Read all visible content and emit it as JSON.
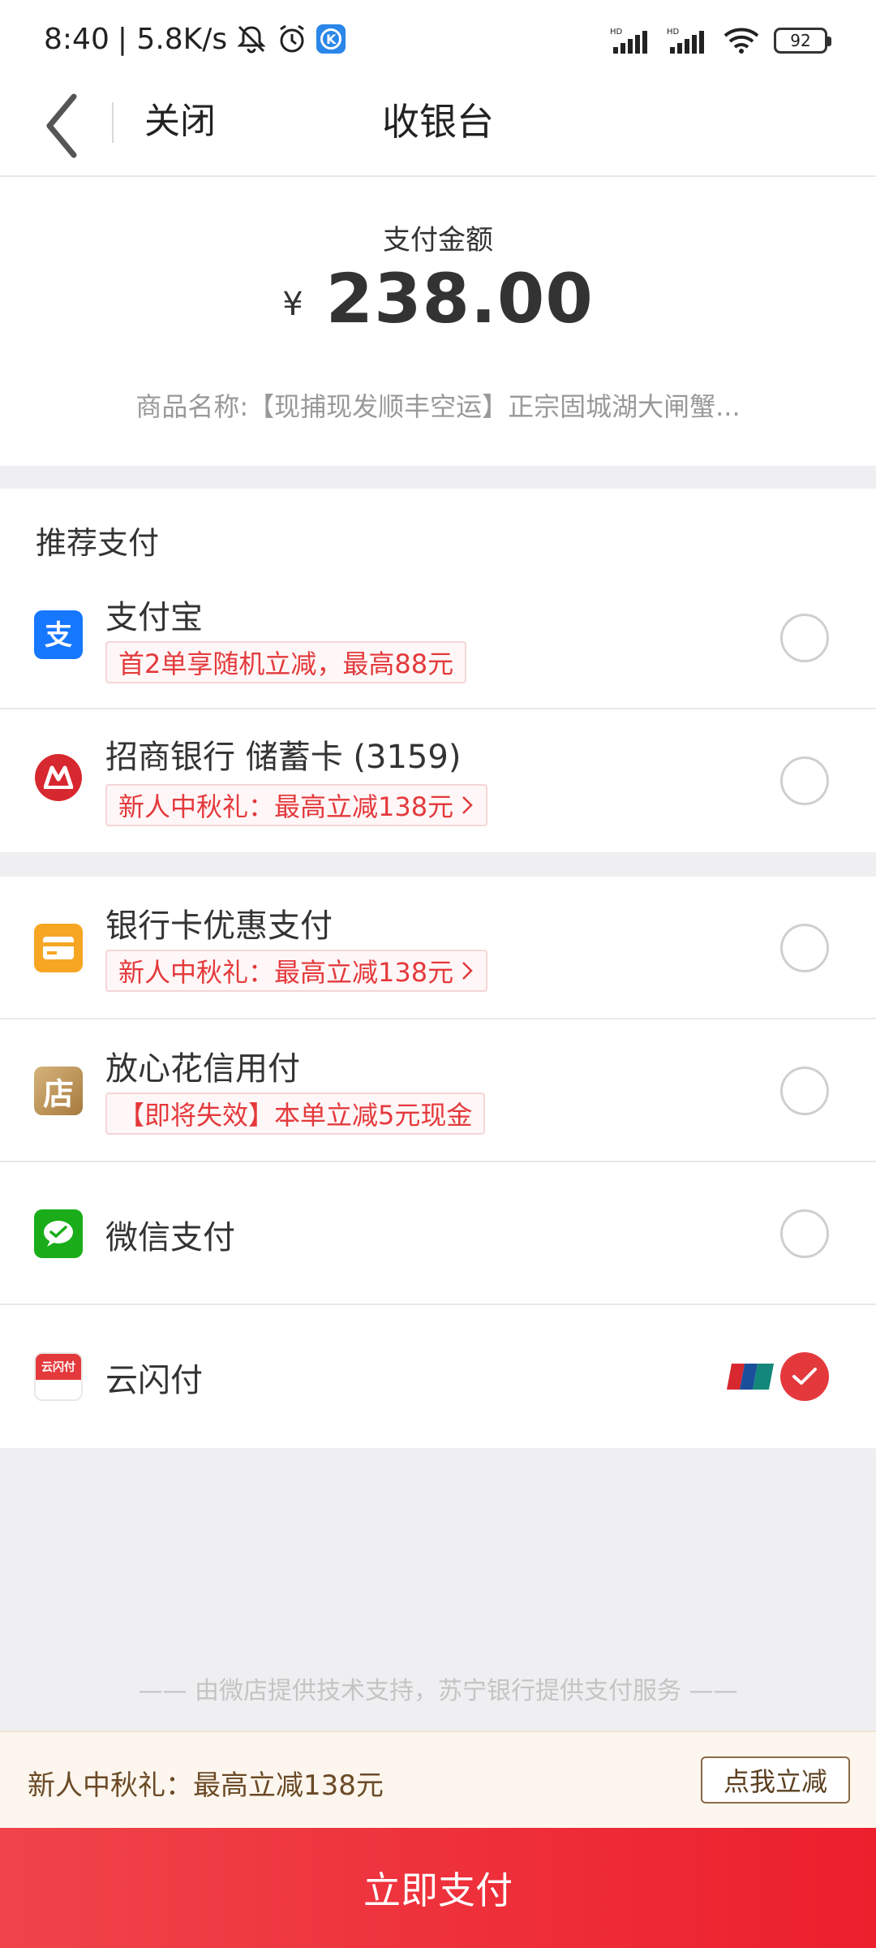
{
  "status_bar": {
    "time": "8:40",
    "net_speed": "| 5.8K/s",
    "battery": "92",
    "icons": [
      "mute-icon",
      "alarm-icon",
      "k-app-icon",
      "hd-signal-icon",
      "hd-signal-icon",
      "wifi-icon",
      "battery-icon"
    ]
  },
  "nav": {
    "close_label": "关闭",
    "title": "收银台"
  },
  "amount": {
    "label": "支付金额",
    "currency": "¥",
    "value": "238.00",
    "product_name": "商品名称:【现捕现发顺丰空运】正宗固城湖大闸蟹..."
  },
  "recommended": {
    "title": "推荐支付",
    "items": [
      {
        "name": "支付宝",
        "promo": "首2单享随机立减，最高88元",
        "icon": "alipay-icon",
        "color": "#1677ff",
        "selected": false
      },
      {
        "name": "招商银行 储蓄卡 (3159)",
        "promo": "新人中秋礼：最高立减138元",
        "icon": "cmb-icon",
        "color": "#d7282f",
        "selected": false
      }
    ]
  },
  "other": {
    "items": [
      {
        "name": "银行卡优惠支付",
        "promo": "新人中秋礼：最高立减138元",
        "icon": "bank-card-icon",
        "color": "#f6a623",
        "selected": false
      },
      {
        "name": "放心花信用付",
        "promo": "【即将失效】本单立减5元现金",
        "icon": "store-icon",
        "icon_text": "店",
        "color": "#c49a5a",
        "selected": false
      },
      {
        "name": "微信支付",
        "icon": "wechat-pay-icon",
        "color": "#1aad19",
        "selected": false
      },
      {
        "name": "云闪付",
        "icon": "cloud-quickpass-icon",
        "icon_text": "云闪付",
        "color": "#e4393c",
        "selected": true,
        "badge": "unionpay-logo-icon"
      }
    ]
  },
  "footer_note": "—— 由微店提供技术支持，苏宁银行提供支付服务 ——",
  "promo_bar": {
    "text": "新人中秋礼：最高立减138元",
    "button": "点我立减"
  },
  "pay_button": "立即支付",
  "colors": {
    "accent": "#e4393c",
    "promo_text": "#e4393c",
    "promo_bar_bg": "#fcf6ee"
  }
}
